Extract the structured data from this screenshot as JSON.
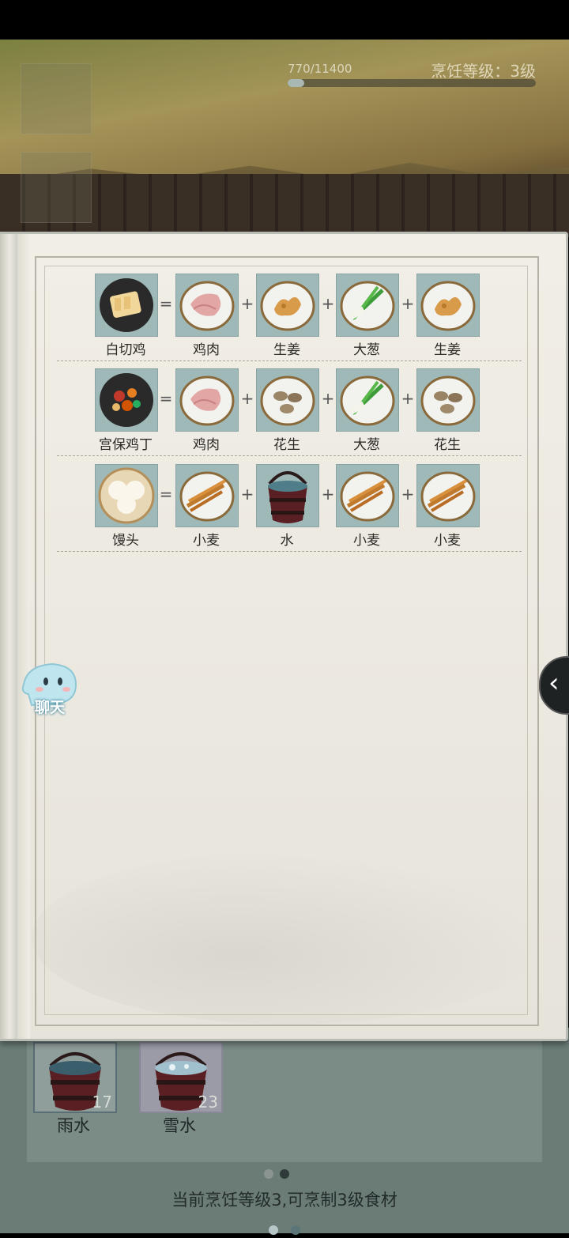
{
  "hud": {
    "xp_text": "770/11400",
    "xp_progress": 0.0675,
    "cooking_level": "烹饪等级：3级"
  },
  "recipes": [
    {
      "dish": {
        "name": "白切鸡",
        "icon": "white-cut-chicken-icon"
      },
      "ingredients": [
        {
          "name": "鸡肉",
          "icon": "chicken-meat-icon"
        },
        {
          "name": "生姜",
          "icon": "ginger-icon"
        },
        {
          "name": "大葱",
          "icon": "scallion-icon"
        },
        {
          "name": "生姜",
          "icon": "ginger-icon"
        }
      ]
    },
    {
      "dish": {
        "name": "宫保鸡丁",
        "icon": "kung-pao-chicken-icon"
      },
      "ingredients": [
        {
          "name": "鸡肉",
          "icon": "chicken-meat-icon"
        },
        {
          "name": "花生",
          "icon": "peanut-icon"
        },
        {
          "name": "大葱",
          "icon": "scallion-icon"
        },
        {
          "name": "花生",
          "icon": "peanut-icon"
        }
      ]
    },
    {
      "dish": {
        "name": "馒头",
        "icon": "steamed-bun-icon"
      },
      "ingredients": [
        {
          "name": "小麦",
          "icon": "wheat-icon"
        },
        {
          "name": "水",
          "icon": "water-bucket-icon"
        },
        {
          "name": "小麦",
          "icon": "wheat-icon"
        },
        {
          "name": "小麦",
          "icon": "wheat-icon"
        }
      ]
    }
  ],
  "symbols": {
    "equals": "=",
    "plus": "+"
  },
  "book_pager": {
    "pages": 2,
    "active": 2
  },
  "chat": {
    "label": "聊天"
  },
  "inventory": {
    "items": [
      {
        "name": "雨水",
        "count": "17",
        "icon": "rain-water-bucket-icon"
      },
      {
        "name": "雪水",
        "count": "23",
        "icon": "snow-water-bucket-icon"
      }
    ],
    "pager": {
      "pages": 2,
      "active": 2
    },
    "note": "当前烹饪等级3,可烹制3级食材"
  },
  "colors": {
    "slot_bg": "#9fb9b8",
    "page_bg": "#eeebe3",
    "dot_active": "#5a7679",
    "dot_inactive": "#b7c7c9"
  }
}
